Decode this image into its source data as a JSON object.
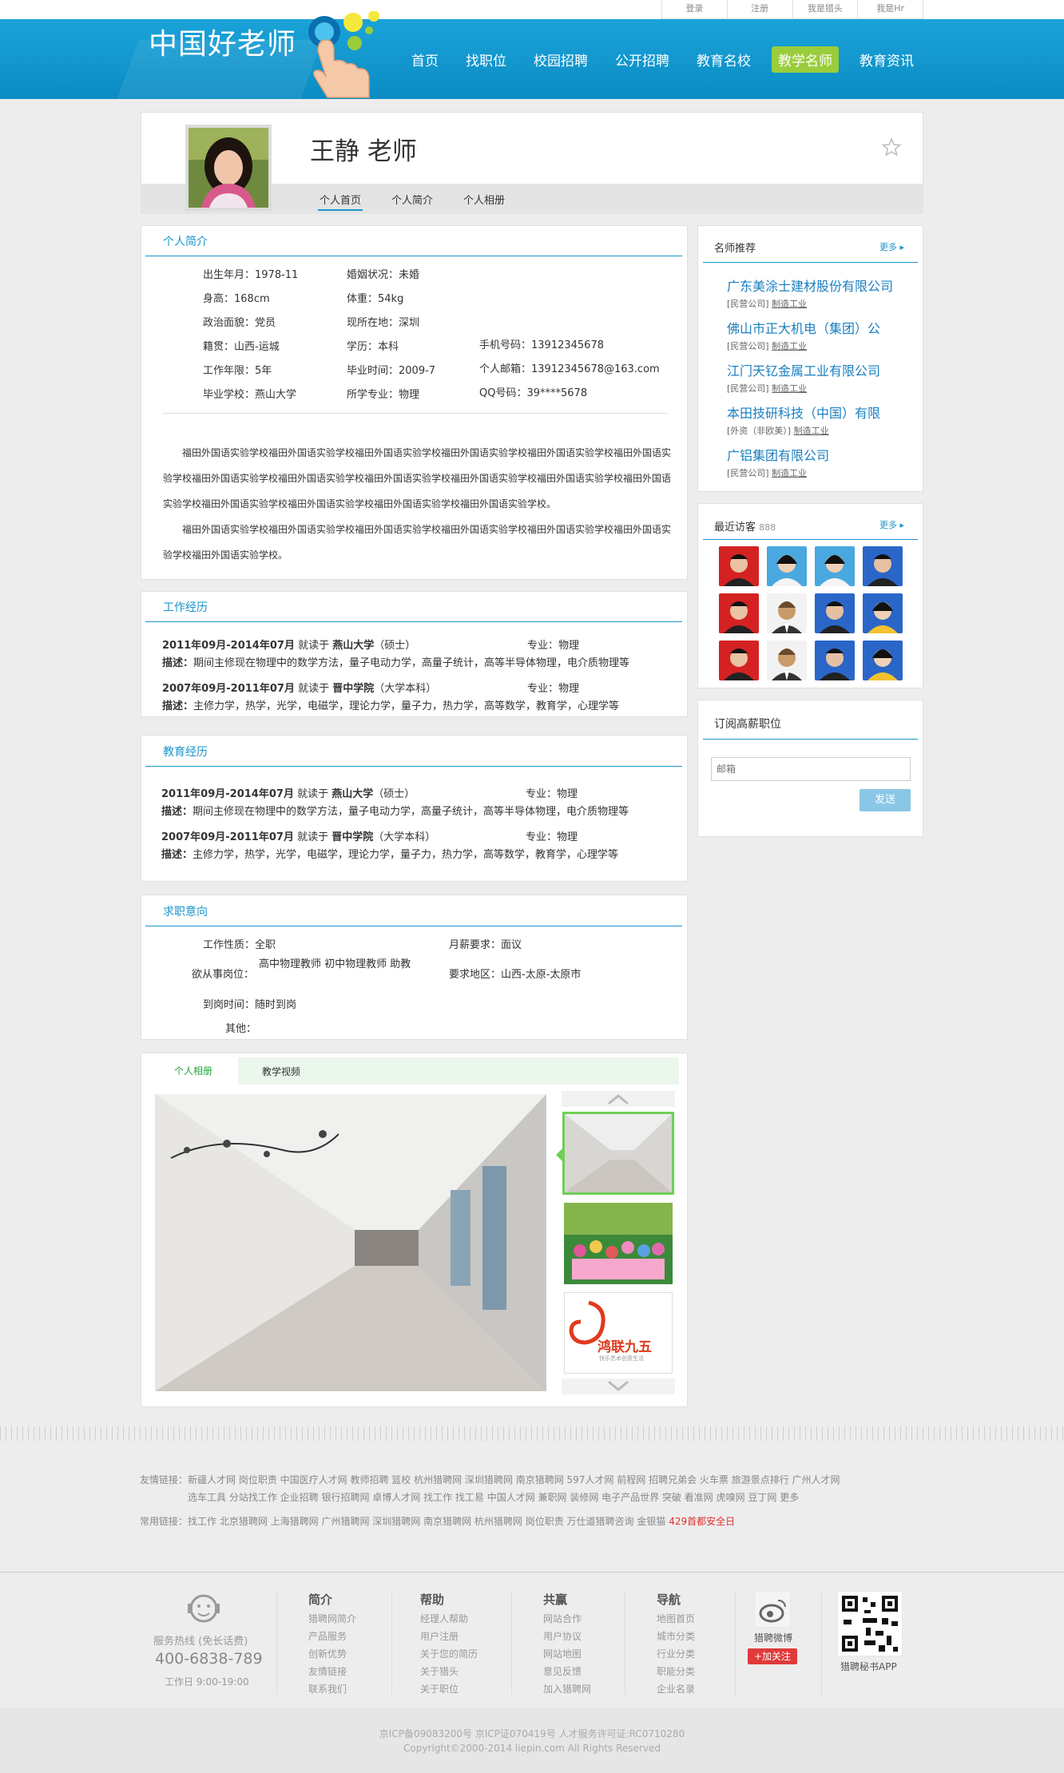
{
  "topbar": {
    "links": [
      "登录",
      "注册",
      "我是猎头",
      "我是Hr"
    ]
  },
  "header": {
    "logo": "中国好老师",
    "nav": [
      "首页",
      "找职位",
      "校园招聘",
      "公开招聘",
      "教育名校",
      "教学名师",
      "教育资讯"
    ],
    "active_index": 5
  },
  "profile": {
    "name": "王静 老师",
    "tabs": [
      "个人首页",
      "个人简介",
      "个人相册"
    ]
  },
  "intro": {
    "title": "个人简介",
    "fields": {
      "birth": "出生年月：1978-11",
      "marriage": "婚姻状况：未婚",
      "height": "身高：168cm",
      "weight": "体重：54kg",
      "politics": "政治面貌：党员",
      "location": "现所在地：深圳",
      "origin": "籍贯：山西-运城",
      "education": "学历：本科",
      "phone": "手机号码：13912345678",
      "years": "工作年限：5年",
      "grad_time": "毕业时间：2009-7",
      "email": "个人邮箱：13912345678@163.com",
      "school": "毕业学校：燕山大学",
      "major": "所学专业：物理",
      "qq": "QQ号码：39****5678"
    },
    "para1": "福田外国语实验学校福田外国语实验学校福田外国语实验学校福田外国语实验学校福田外国语实验学校福田外国语实验学校福田外国语实验学校福田外国语实验学校福田外国语实验学校福田外国语实验学校福田外国语实验学校福田外国语实验学校福田外国语实验学校福田外国语实验学校福田外国语实验学校福田外国语实验学校。",
    "para2": "福田外国语实验学校福田外国语实验学校福田外国语实验学校福田外国语实验学校福田外国语实验学校福田外国语实验学校福田外国语实验学校。"
  },
  "work": {
    "title": "工作经历",
    "items": [
      {
        "head": "2011年09月-2014年07月",
        "mid": " 就读于 ",
        "school": "燕山大学",
        "deg": "（硕士）",
        "major": "专业：物理",
        "desc_label": "描述：",
        "desc": "期间主修现在物理中的数学方法，量子电动力学，高量子统计，高等半导体物理，电介质物理等"
      },
      {
        "head": "2007年09月-2011年07月",
        "mid": " 就读于 ",
        "school": "晋中学院",
        "deg": "（大学本科）",
        "major": "专业：物理",
        "desc_label": "描述：",
        "desc": "主修力学，热学，光学，电磁学，理论力学，量子力，热力学，高等数学，教育学，心理学等"
      }
    ]
  },
  "edu": {
    "title": "教育经历",
    "items": [
      {
        "head": "2011年09月-2014年07月",
        "mid": " 就读于 ",
        "school": "燕山大学",
        "deg": "（硕士）",
        "major": "专业：物理",
        "desc_label": "描述：",
        "desc": "期间主修现在物理中的数学方法，量子电动力学，高量子统计，高等半导体物理，电介质物理等"
      },
      {
        "head": "2007年09月-2011年07月",
        "mid": " 就读于 ",
        "school": "晋中学院",
        "deg": "（大学本科）",
        "major": "专业：物理",
        "desc_label": "描述：",
        "desc": "主修力学，热学，光学，电磁学，理论力学，量子力，热力学，高等数学，教育学，心理学等"
      }
    ]
  },
  "intent": {
    "title": "求职意向",
    "type_label": "工作性质：",
    "type": "全职",
    "salary_label": "月薪要求：",
    "salary": "面议",
    "post_label": "欲从事岗位：",
    "post": "高中物理教师 初中物理教师 助教",
    "area_label": "要求地区：",
    "area": "山西-太原-太原市",
    "arrive_label": "到岗时间：",
    "arrive": "随时到岗",
    "other_label": "其他：",
    "other": ""
  },
  "album": {
    "tabs": [
      "个人相册",
      "教学视频"
    ],
    "logo_text": "鸿联九五",
    "logo_sub": "快乐艺术创意生活"
  },
  "recommend": {
    "title": "名师推荐",
    "more": "更多 ▸",
    "items": [
      {
        "name": "广东美涂士建材股份有限公司",
        "meta": "[民营公司]",
        "industry": "制造工业"
      },
      {
        "name": "佛山市正大机电（集团）公",
        "meta": "[民营公司]",
        "industry": "制造工业"
      },
      {
        "name": "江门天钇金属工业有限公司",
        "meta": "[民营公司]",
        "industry": "制造工业"
      },
      {
        "name": "本田技研科技（中国）有限",
        "meta": "[外资（非欧美）]",
        "industry": "制造工业"
      },
      {
        "name": "广铝集团有限公司",
        "meta": "[民营公司]",
        "industry": "制造工业"
      }
    ]
  },
  "visitors": {
    "title": "最近访客",
    "count": "888",
    "more": "更多 ▸"
  },
  "subscribe": {
    "title": "订阅高薪职位",
    "placeholder": "邮箱",
    "button": "发送"
  },
  "friend_links": {
    "label": "友情链接：",
    "line1": "新疆人才网  岗位职责  中国医疗人才网  教师招聘  篮校  杭州猎聘网  深圳猎聘网  南京猎聘网  597人才网  前程网  招聘兄弟会  火车票  旅游景点排行  广州人才网",
    "line2": "选车工具  分站找工作  企业招聘  银行招聘网  卓博人才网  找工作  找工易  中国人才网  兼职网  装修网  电子产品世界  突破  看准网  虎嗅网  豆丁网  更多"
  },
  "common_links": {
    "label": "常用链接：",
    "text": "找工作  北京猎聘网  上海猎聘网  广州猎聘网  深圳猎聘网  南京猎聘网  杭州猎聘网  岗位职责  万仕道猎聘咨询  金银猫",
    "red": "429首都安全日"
  },
  "footer": {
    "service_label": "服务热线 (免长话费)",
    "phone": "400-6838-789",
    "hours": "工作日 9:00-19:00",
    "cols": [
      {
        "h": "简介",
        "items": [
          "猎聘网简介",
          "产品服务",
          "创新优势",
          "友情链接",
          "联系我们"
        ]
      },
      {
        "h": "帮助",
        "items": [
          "经理人帮助",
          "用户注册",
          "关于您的简历",
          "关于猎头",
          "关于职位"
        ]
      },
      {
        "h": "共赢",
        "items": [
          "网站合作",
          "用户协议",
          "网站地图",
          "意见反馈",
          "加入猎聘网"
        ]
      },
      {
        "h": "导航",
        "items": [
          "地图首页",
          "城市分类",
          "行业分类",
          "职能分类",
          "企业名录"
        ]
      }
    ],
    "weibo": "猎聘微博",
    "follow": "+加关注",
    "app": "猎聘秘书APP",
    "icp": "京ICP备09083200号 京ICP证070419号 人才服务许可证:RC0710280",
    "copyright": "Copyright©2000-2014 liepin.com All Rights Reserved"
  },
  "colors": {
    "brand": "#1aa3d9",
    "accent_green": "#9acd3c",
    "link": "#1a7fc0"
  }
}
